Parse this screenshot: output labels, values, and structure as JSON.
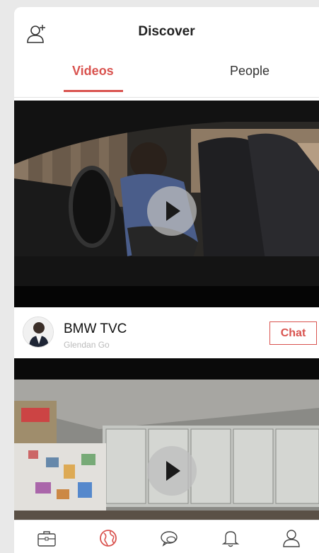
{
  "header": {
    "title": "Discover",
    "add_user_icon": "add-user-icon"
  },
  "tabs": [
    {
      "label": "Videos",
      "active": true
    },
    {
      "label": "People",
      "active": false
    }
  ],
  "feed": [
    {
      "title": "BMW TVC",
      "author": "Glendan Go",
      "chat_label": "Chat",
      "play_icon": "play-icon"
    },
    {
      "play_icon": "play-icon"
    }
  ],
  "tabbar": {
    "items": [
      {
        "icon": "briefcase-icon",
        "active": false
      },
      {
        "icon": "globe-icon",
        "active": true
      },
      {
        "icon": "chat-bubbles-icon",
        "active": false
      },
      {
        "icon": "bell-icon",
        "active": false
      },
      {
        "icon": "profile-icon",
        "active": false
      }
    ]
  },
  "colors": {
    "accent": "#d9534f",
    "text": "#222222",
    "muted": "#bbbbbb"
  }
}
